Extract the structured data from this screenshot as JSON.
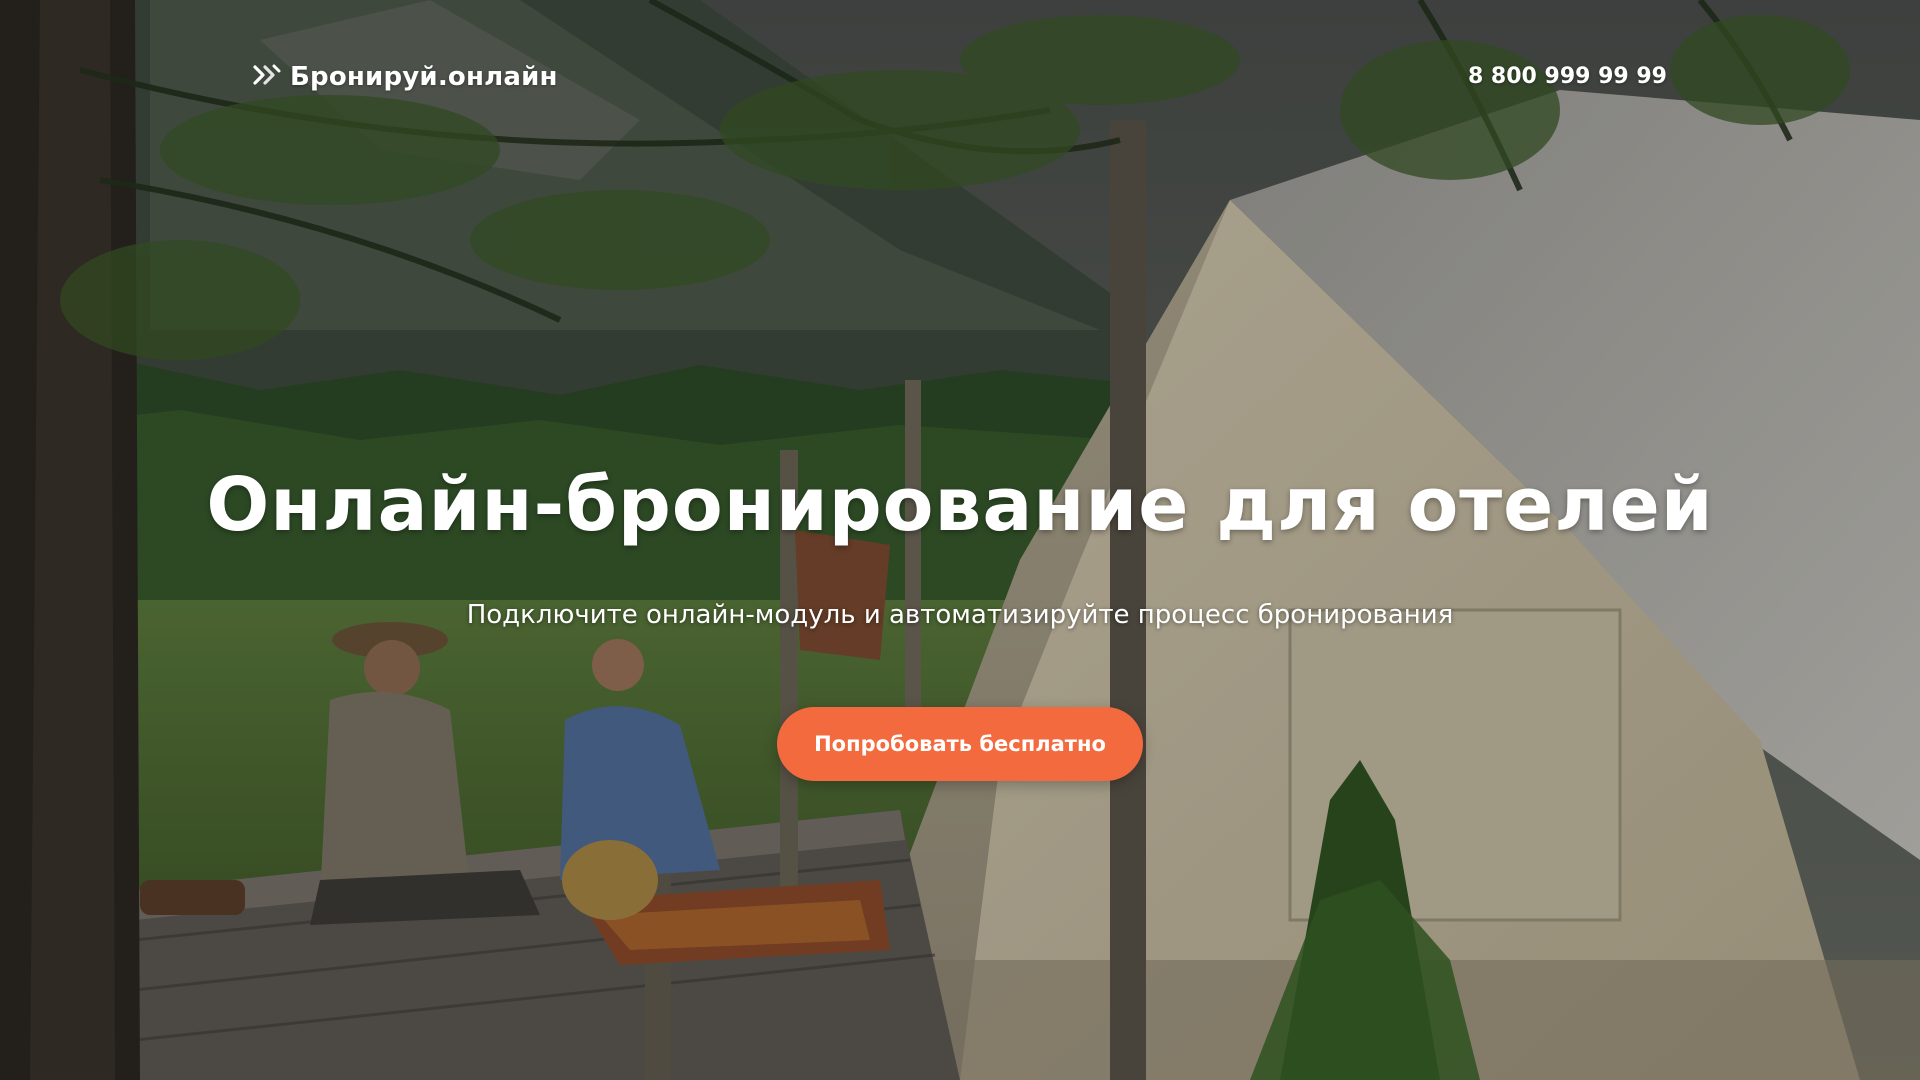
{
  "header": {
    "brand_name": "Бронируй.онлайн",
    "phone": "8 800 999 99 99"
  },
  "hero": {
    "title": "Онлайн-бронирование для отелей",
    "subtitle": "Подключите онлайн-модуль и автоматизируйте процесс бронирования",
    "cta_label": "Попробовать бесплатно"
  },
  "icons": {
    "logo": "brand-logo-icon"
  },
  "colors": {
    "accent": "#f26a3d",
    "text": "#ffffff"
  }
}
